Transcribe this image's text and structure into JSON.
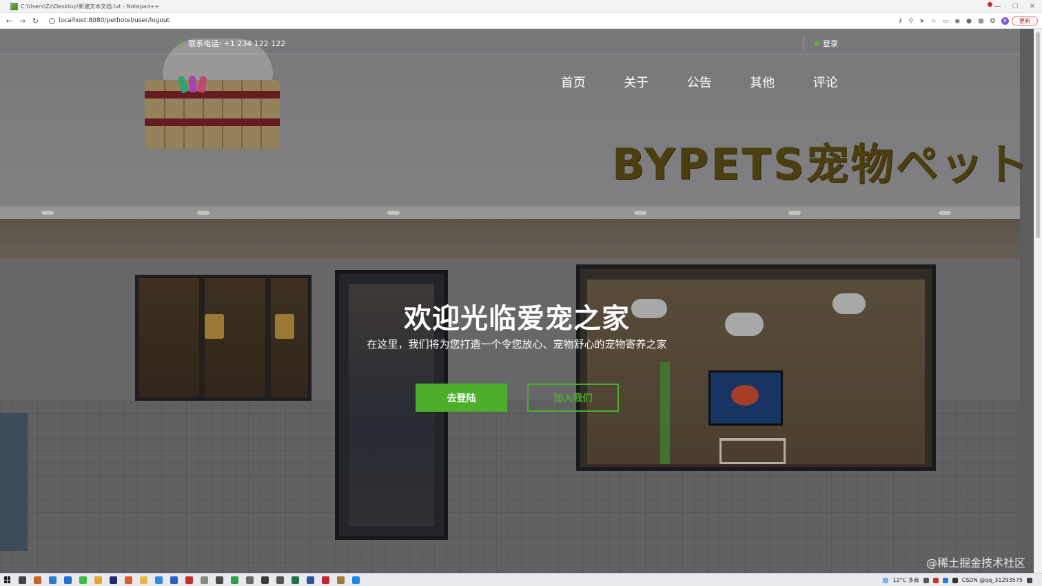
{
  "window": {
    "title": "C:\\Users\\Zz\\Desktop\\新建文本文档.txt - Notepad++",
    "controls": [
      "—",
      "☐",
      "✕"
    ]
  },
  "browser": {
    "url": "localhost:8080/pethotel/user/logout",
    "back_icon": "arrow-left-icon",
    "forward_icon": "arrow-right-icon",
    "reload_icon": "reload-icon",
    "toolbar_icons": [
      "key-icon",
      "zoom-icon",
      "send-icon",
      "star-icon",
      "cast-icon",
      "camera-icon",
      "translate-icon",
      "image-icon",
      "extensions-icon"
    ],
    "profile_initial": "8",
    "update_label": "更新"
  },
  "site": {
    "topbar": {
      "phone_label": "联系电话: +1 234 122 122",
      "login_label": "登录"
    },
    "nav": [
      {
        "label": "首页"
      },
      {
        "label": "关于"
      },
      {
        "label": "公告"
      },
      {
        "label": "其他"
      },
      {
        "label": "评论"
      }
    ],
    "store_sign": "BYPETS宠物ペット",
    "hero": {
      "title": "欢迎光临爱宠之家",
      "subtitle": "在这里，我们将为您打造一个令您放心、宠物舒心的宠物寄养之家",
      "primary_button": "去登陆",
      "secondary_button": "加入我们"
    },
    "watermark": "@稀土掘金技术社区"
  },
  "taskbar": {
    "weather": "12°C 多云",
    "tray_text": "CSDN @qq_31293575"
  },
  "colors": {
    "accent_green": "#4caf2b",
    "titlebar_bg": "#f3f3f3",
    "taskbar_bg": "#e9eaee"
  }
}
